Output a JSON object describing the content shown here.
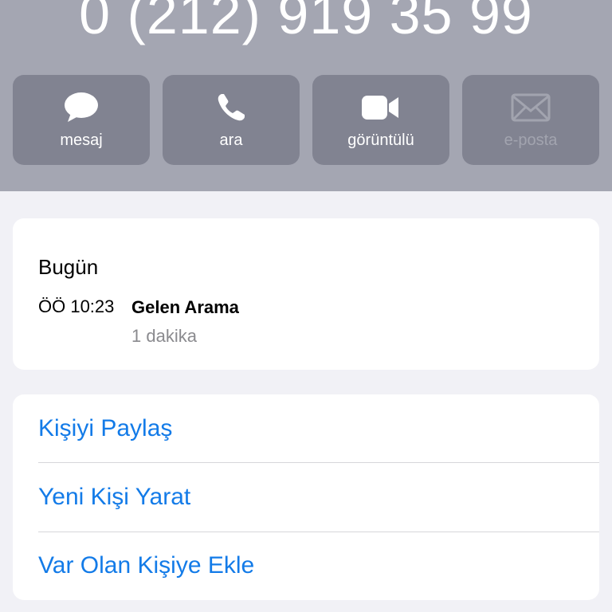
{
  "header": {
    "phone_number": "0 (212) 919 35 99",
    "actions": [
      {
        "label": "mesaj",
        "icon": "message-icon",
        "enabled": true
      },
      {
        "label": "ara",
        "icon": "phone-icon",
        "enabled": true
      },
      {
        "label": "görüntülü",
        "icon": "video-icon",
        "enabled": true
      },
      {
        "label": "e-posta",
        "icon": "mail-icon",
        "enabled": false
      }
    ]
  },
  "recents": {
    "day": "Bugün",
    "time": "ÖÖ 10:23",
    "call_type": "Gelen Arama",
    "duration": "1 dakika"
  },
  "options": [
    {
      "label": "Kişiyi Paylaş"
    },
    {
      "label": "Yeni Kişi Yarat"
    },
    {
      "label": "Var Olan Kişiye Ekle"
    }
  ],
  "colors": {
    "header_bg": "#a4a6b2",
    "action_bg": "#818391",
    "link": "#137be8",
    "secondary_text": "#8a8a8e"
  }
}
